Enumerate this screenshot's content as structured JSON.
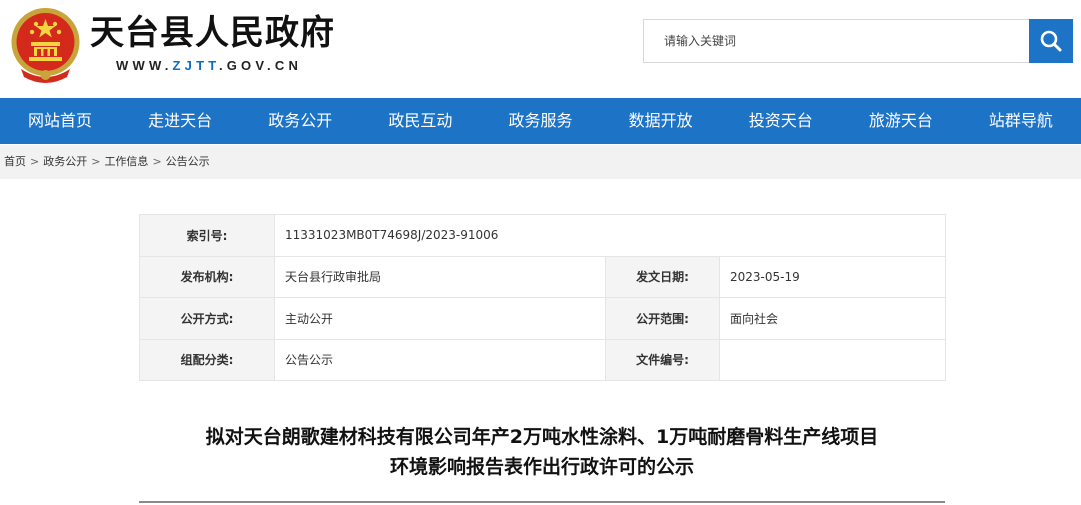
{
  "header": {
    "site_title": "天台县人民政府",
    "site_url_prefix": "WWW.",
    "site_url_highlight": "ZJTT",
    "site_url_suffix": ".GOV.CN",
    "emblem_icon": "national-emblem-icon",
    "brand_color": "#1d73c6"
  },
  "search": {
    "placeholder": "请输入关键词",
    "button_icon": "search-icon"
  },
  "nav": {
    "items": [
      "网站首页",
      "走进天台",
      "政务公开",
      "政民互动",
      "政务服务",
      "数据开放",
      "投资天台",
      "旅游天台",
      "站群导航"
    ]
  },
  "breadcrumb": {
    "items": [
      "首页",
      "政务公开",
      "工作信息",
      "公告公示"
    ],
    "separator": ">"
  },
  "meta": {
    "index_label": "索引号:",
    "index_value": "11331023MB0T74698J/2023-91006",
    "publisher_label": "发布机构:",
    "publisher_value": "天台县行政审批局",
    "date_label": "发文日期:",
    "date_value": "2023-05-19",
    "method_label": "公开方式:",
    "method_value": "主动公开",
    "scope_label": "公开范围:",
    "scope_value": "面向社会",
    "category_label": "组配分类:",
    "category_value": "公告公示",
    "docno_label": "文件编号:",
    "docno_value": ""
  },
  "article": {
    "title_line1": "拟对天台朗歌建材科技有限公司年产2万吨水性涂料、1万吨耐磨骨料生产线项目",
    "title_line2": "环境影响报告表作出行政许可的公示"
  }
}
